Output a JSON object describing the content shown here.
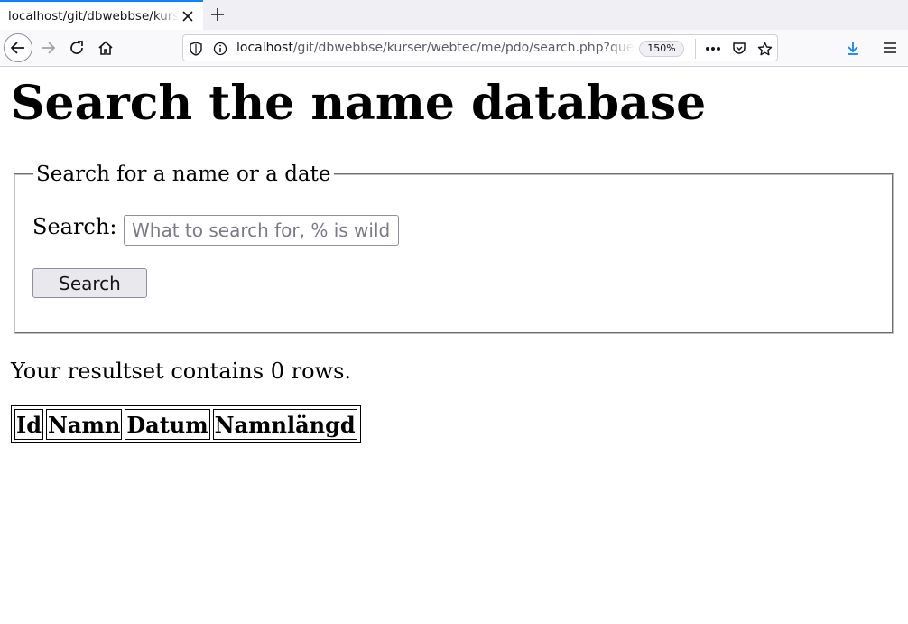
{
  "browser": {
    "tab_title": "localhost/git/dbwebbse/kurs",
    "url_host": "localhost",
    "url_path": "/git/dbwebbse/kurser/webtec/me/pdo/search.php?que",
    "zoom": "150%"
  },
  "page": {
    "heading": "Search the name database",
    "fieldset_legend": "Search for a name or a date",
    "search_label": "Search:",
    "search_placeholder": "What to search for, % is wild",
    "search_value": "",
    "search_button": "Search",
    "result_text": "Your resultset contains 0 rows.",
    "table": {
      "columns": [
        "Id",
        "Namn",
        "Datum",
        "Namnlängd"
      ],
      "rows": []
    }
  },
  "colors": {
    "tab_accent": "#0a84ff",
    "download_icon": "#0a84ff"
  },
  "icons": [
    "close-icon",
    "plus-icon",
    "back-arrow-icon",
    "forward-arrow-icon",
    "reload-icon",
    "home-icon",
    "shield-icon",
    "info-icon",
    "more-icon",
    "pocket-icon",
    "star-icon",
    "download-icon",
    "hamburger-menu-icon"
  ]
}
